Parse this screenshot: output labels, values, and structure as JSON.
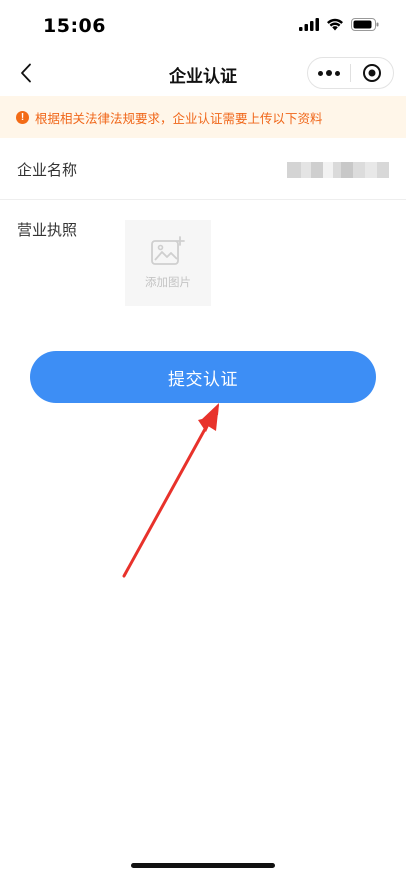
{
  "status": {
    "time": "15:06",
    "icons": [
      "signal-icon",
      "wifi-icon",
      "battery-icon"
    ]
  },
  "nav": {
    "title": "企业认证",
    "back_icon": "chevron-left-icon",
    "more_icon": "more-dots-icon",
    "close_icon": "target-close-icon"
  },
  "notice": {
    "icon": "!",
    "text": "根据相关法律法规要求，企业认证需要上传以下资料"
  },
  "form": {
    "company_label": "企业名称",
    "license_label": "营业执照",
    "upload_label": "添加图片"
  },
  "submit": {
    "label": "提交认证"
  },
  "colors": {
    "primary": "#3d8ef5",
    "notice_bg": "#fff6e9",
    "notice_text": "#f0671a",
    "annotation_arrow": "#e8322b"
  }
}
